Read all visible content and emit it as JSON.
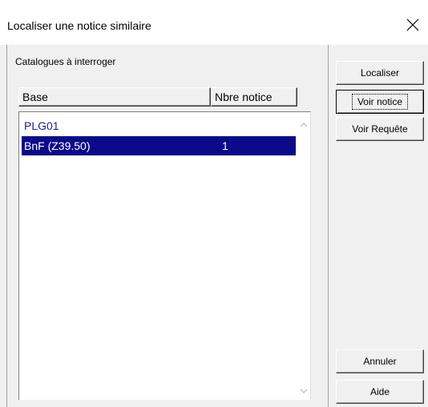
{
  "window": {
    "title": "Localiser une notice similaire"
  },
  "panel": {
    "group_label": "Catalogues à interroger"
  },
  "table": {
    "columns": [
      "Base",
      "Nbre notice"
    ],
    "rows": [
      {
        "base": "PLG01",
        "count": ""
      },
      {
        "base": "BnF (Z39.50)",
        "count": "1",
        "selected": true
      }
    ]
  },
  "buttons": {
    "localiser": "Localiser",
    "voir_notice": "Voir notice",
    "voir_requete": "Voir Requête",
    "annuler": "Annuler",
    "aide": "Aide"
  },
  "colors": {
    "selection": "#0a0a8a",
    "link_text": "#1c1c96",
    "face": "#f0f0f0"
  },
  "icons": {
    "close": "close-icon",
    "scroll_up": "chevron-up-icon",
    "scroll_down": "chevron-down-icon"
  }
}
